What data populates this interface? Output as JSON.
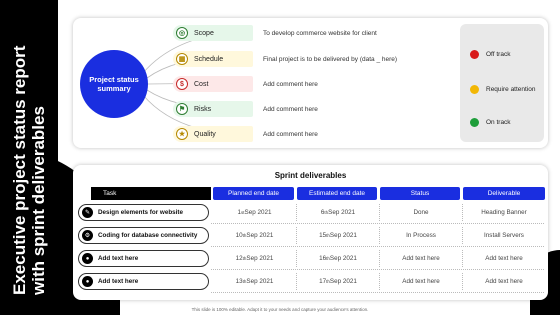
{
  "title": "Executive project status report with sprint deliverables",
  "summary": {
    "circle_label": "Project status summary",
    "items": [
      {
        "label": "Scope",
        "comment": "To develop commerce website for client",
        "color": "#e6f7ea",
        "icon_color": "#2e7d32",
        "icon": "target-icon"
      },
      {
        "label": "Schedule",
        "comment": "Final project is to be delivered by (data _ here)",
        "color": "#fff8dc",
        "icon_color": "#b58900",
        "icon": "calendar-icon"
      },
      {
        "label": "Cost",
        "comment": "Add comment here",
        "color": "#fde8e8",
        "icon_color": "#c62828",
        "icon": "cost-icon"
      },
      {
        "label": "Risks",
        "comment": "Add comment here",
        "color": "#e6f7ea",
        "icon_color": "#2e7d32",
        "icon": "risk-icon"
      },
      {
        "label": "Quality",
        "comment": "Add comment here",
        "color": "#fff8dc",
        "icon_color": "#b58900",
        "icon": "quality-icon"
      }
    ]
  },
  "legend": [
    {
      "label": "Off track",
      "color": "#d81b1b"
    },
    {
      "label": "Require attention",
      "color": "#f2b705"
    },
    {
      "label": "On track",
      "color": "#1e9e3a"
    }
  ],
  "sprint": {
    "title": "Sprint deliverables",
    "headers": {
      "task": "Task",
      "planned": "Planned end date",
      "estimated": "Estimated end date",
      "status": "Status",
      "deliverable": "Deliverable"
    },
    "rows": [
      {
        "task": "Design elements for website",
        "icon": "design-icon",
        "planned_day": "1",
        "planned_sup": "st",
        "planned_rest": " Sep 2021",
        "est_day": "6",
        "est_sup": "th",
        "est_rest": " Sep 2021",
        "status": "Done",
        "deliverable": "Heading Banner"
      },
      {
        "task": "Coding for database connectivity",
        "icon": "code-icon",
        "planned_day": "10",
        "planned_sup": "th",
        "planned_rest": " Sep 2021",
        "est_day": "15",
        "est_sup": "th",
        "est_rest": " Sep 2021",
        "status": "In Process",
        "deliverable": "Install Servers"
      },
      {
        "task": "Add text here",
        "icon": "generic-icon",
        "planned_day": "12",
        "planned_sup": "th",
        "planned_rest": " Sep 2021",
        "est_day": "16",
        "est_sup": "th",
        "est_rest": " Sep 2021",
        "status": "Add text here",
        "deliverable": "Add text here"
      },
      {
        "task": "Add text here",
        "icon": "generic-icon",
        "planned_day": "13",
        "planned_sup": "th",
        "planned_rest": " Sep 2021",
        "est_day": "17",
        "est_sup": "th",
        "est_rest": " Sep 2021",
        "status": "Add text here",
        "deliverable": "Add text here"
      }
    ]
  },
  "footnote": "This slide is 100% editable. Adapt it to your needs and capture your audience's attention."
}
